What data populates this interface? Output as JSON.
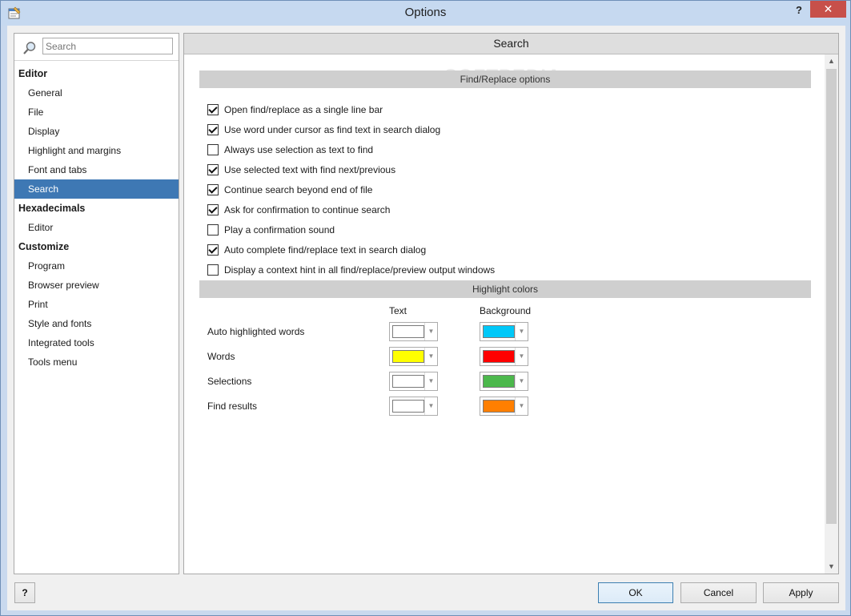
{
  "window": {
    "title": "Options",
    "help_label": "?",
    "close_label": "✕"
  },
  "nav": {
    "search_placeholder": "Search",
    "items": [
      {
        "label": "Editor",
        "type": "group"
      },
      {
        "label": "General",
        "type": "item"
      },
      {
        "label": "File",
        "type": "item"
      },
      {
        "label": "Display",
        "type": "item"
      },
      {
        "label": "Highlight and margins",
        "type": "item"
      },
      {
        "label": "Font and tabs",
        "type": "item"
      },
      {
        "label": "Search",
        "type": "item",
        "selected": true
      },
      {
        "label": "Hexadecimals",
        "type": "group"
      },
      {
        "label": "Editor",
        "type": "item"
      },
      {
        "label": "Customize",
        "type": "group"
      },
      {
        "label": "Program",
        "type": "item"
      },
      {
        "label": "Browser preview",
        "type": "item"
      },
      {
        "label": "Print",
        "type": "item"
      },
      {
        "label": "Style and fonts",
        "type": "item"
      },
      {
        "label": "Integrated tools",
        "type": "item"
      },
      {
        "label": "Tools menu",
        "type": "item"
      }
    ]
  },
  "content": {
    "header": "Search",
    "watermark": "SOFTPEDIA",
    "find_section_title": "Find/Replace options",
    "options": [
      {
        "label": "Open find/replace as a single line bar",
        "checked": true
      },
      {
        "label": "Use word under cursor as find text in search dialog",
        "checked": true
      },
      {
        "label": "Always use selection as text to find",
        "checked": false
      },
      {
        "label": "Use selected text with find next/previous",
        "checked": true
      },
      {
        "label": "Continue search beyond end of file",
        "checked": true
      },
      {
        "label": "Ask for confirmation to continue search",
        "checked": true
      },
      {
        "label": "Play a confirmation sound",
        "checked": false
      },
      {
        "label": "Auto complete find/replace text in search dialog",
        "checked": true
      },
      {
        "label": "Display a context hint in all find/replace/preview output windows",
        "checked": false
      }
    ],
    "highlight_section_title": "Highlight colors",
    "col_text": "Text",
    "col_background": "Background",
    "color_rows": [
      {
        "label": "Auto highlighted words",
        "text_color": "#ffffff",
        "background_color": "#00c8f8"
      },
      {
        "label": "Words",
        "text_color": "#ffff00",
        "background_color": "#ff0000"
      },
      {
        "label": "Selections",
        "text_color": "#ffffff",
        "background_color": "#4cb84c"
      },
      {
        "label": "Find results",
        "text_color": "#ffffff",
        "background_color": "#ff7f00"
      }
    ]
  },
  "buttons": {
    "help": "?",
    "ok": "OK",
    "cancel": "Cancel",
    "apply": "Apply"
  }
}
